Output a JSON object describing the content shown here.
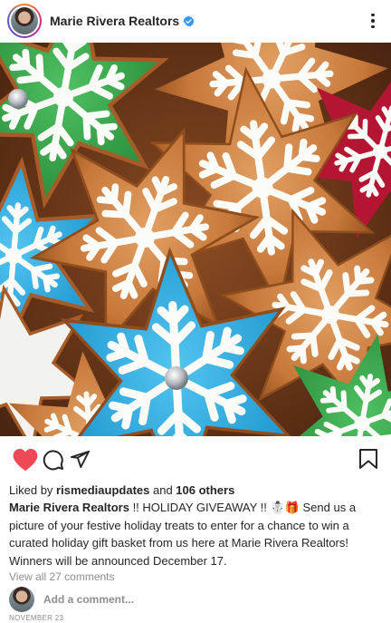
{
  "header": {
    "username": "Marie Rivera Realtors",
    "verified_icon": "verified-badge-icon",
    "menu_icon": "more-options-icon"
  },
  "post": {
    "image_icon": "holiday-cookies-photo",
    "actions": {
      "like_icon": "heart-icon",
      "comment_icon": "comment-icon",
      "share_icon": "paper-plane-icon",
      "save_icon": "bookmark-icon",
      "like_color": "#ed4956"
    },
    "likes": {
      "prefix": "Liked by ",
      "user": "rismediaupdates",
      "middle": " and ",
      "count": "106 others"
    },
    "caption": {
      "author": "Marie Rivera Realtors",
      "text": " !! HOLIDAY GIVEAWAY !! ☃️🎁 Send us a picture of your festive holiday treats to enter for a chance to win a curated holiday gift basket from us here at Marie Rivera Realtors! Winners will be announced December 17."
    },
    "view_comments": "View all 27 comments",
    "add_comment_placeholder": "Add a comment...",
    "date": "November 23"
  }
}
